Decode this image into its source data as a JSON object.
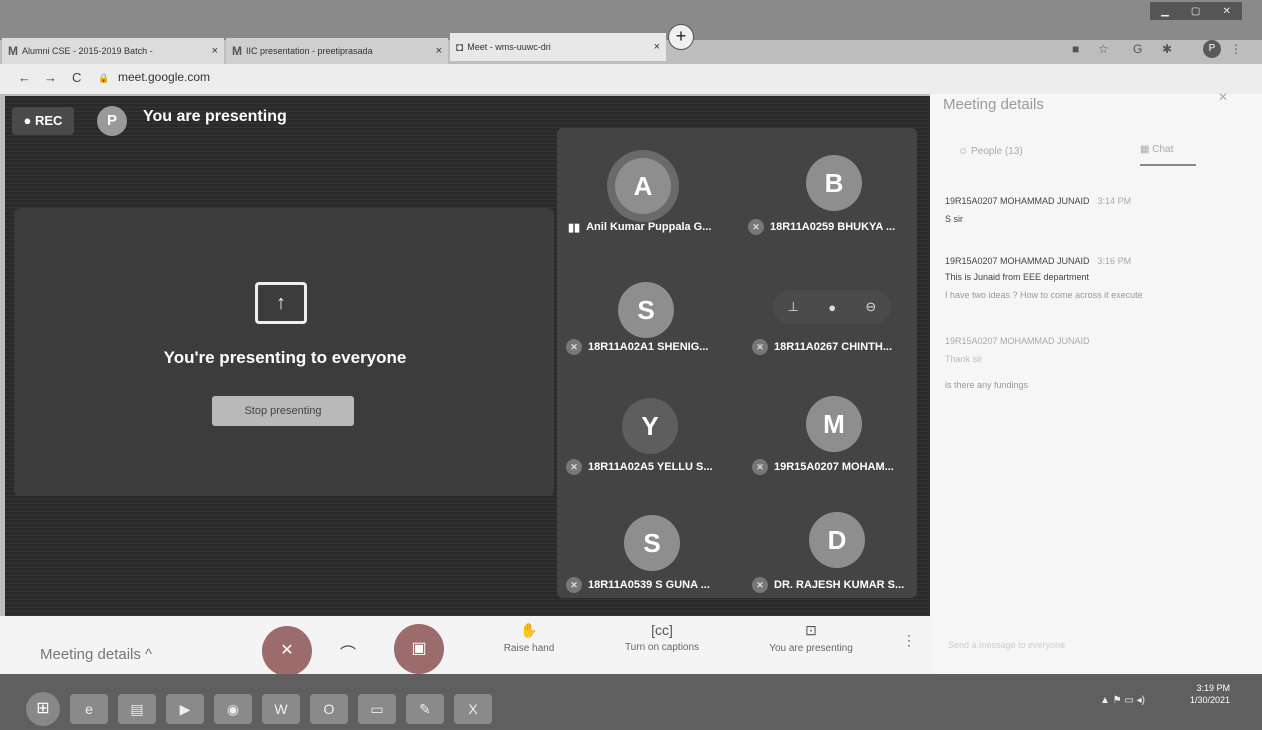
{
  "browser": {
    "tabs": [
      {
        "favicon": "M",
        "title": "Alumni CSE - 2015-2019 Batch -",
        "close": "×"
      },
      {
        "favicon": "M",
        "title": "IIC presentation - preetiprasada",
        "close": "×"
      },
      {
        "favicon": "◘",
        "title": "Meet - wms-uuwc-dri",
        "close": "×"
      }
    ],
    "new_tab": "+",
    "url": "meet.google.com",
    "profile_initial": "P",
    "nav": {
      "back": "←",
      "forward": "→",
      "reload": "C",
      "lock": "🔒"
    }
  },
  "meet": {
    "rec_label": "● REC",
    "presenter_initial": "P",
    "presenting_label": "You are presenting",
    "presenting_title": "You're presenting to everyone",
    "stop_label": "Stop presenting",
    "participants": [
      {
        "initial": "A",
        "name": "Anil Kumar Puppala G...",
        "speaking": true
      },
      {
        "initial": "B",
        "name": "18R11A0259 BHUKYA ...",
        "speaking": false
      },
      {
        "initial": "S",
        "name": "18R11A02A1 SHENIG...",
        "speaking": false
      },
      {
        "initial": "",
        "name": "18R11A0267 CHINTH...",
        "speaking": false
      },
      {
        "initial": "Y",
        "name": "18R11A02A5 YELLU S...",
        "speaking": false
      },
      {
        "initial": "M",
        "name": "19R15A0207 MOHAM...",
        "speaking": false
      },
      {
        "initial": "S",
        "name": "18R11A0539 S GUNA ...",
        "speaking": false
      },
      {
        "initial": "D",
        "name": "DR. RAJESH KUMAR S...",
        "speaking": false
      }
    ]
  },
  "side_panel": {
    "title": "Meeting details",
    "tab_people": "People (13)",
    "tab_chat": "Chat",
    "messages": [
      {
        "sender": "19R15A0207 MOHAMMAD JUNAID",
        "time": "3:14 PM",
        "text": "S sir"
      },
      {
        "sender": "19R15A0207 MOHAMMAD JUNAID",
        "time": "3:16 PM",
        "text": "This is Junaid from EEE department"
      },
      {
        "sender": "",
        "time": "",
        "text": "I have two ideas ? How to come across it execute"
      },
      {
        "sender": "19R15A0207 MOHAMMAD JUNAID",
        "time": "",
        "text": "Thank sir"
      },
      {
        "sender": "",
        "time": "",
        "text": "is there any fundings"
      }
    ],
    "chat_placeholder": "Send a message to everyone"
  },
  "bottom_bar": {
    "details_label": "Meeting details ^",
    "raise_hand": "Raise hand",
    "captions": "Turn on captions",
    "presenting": "You are presenting"
  },
  "taskbar": {
    "clock_time": "3:19 PM",
    "clock_date": "1/30/2021"
  }
}
